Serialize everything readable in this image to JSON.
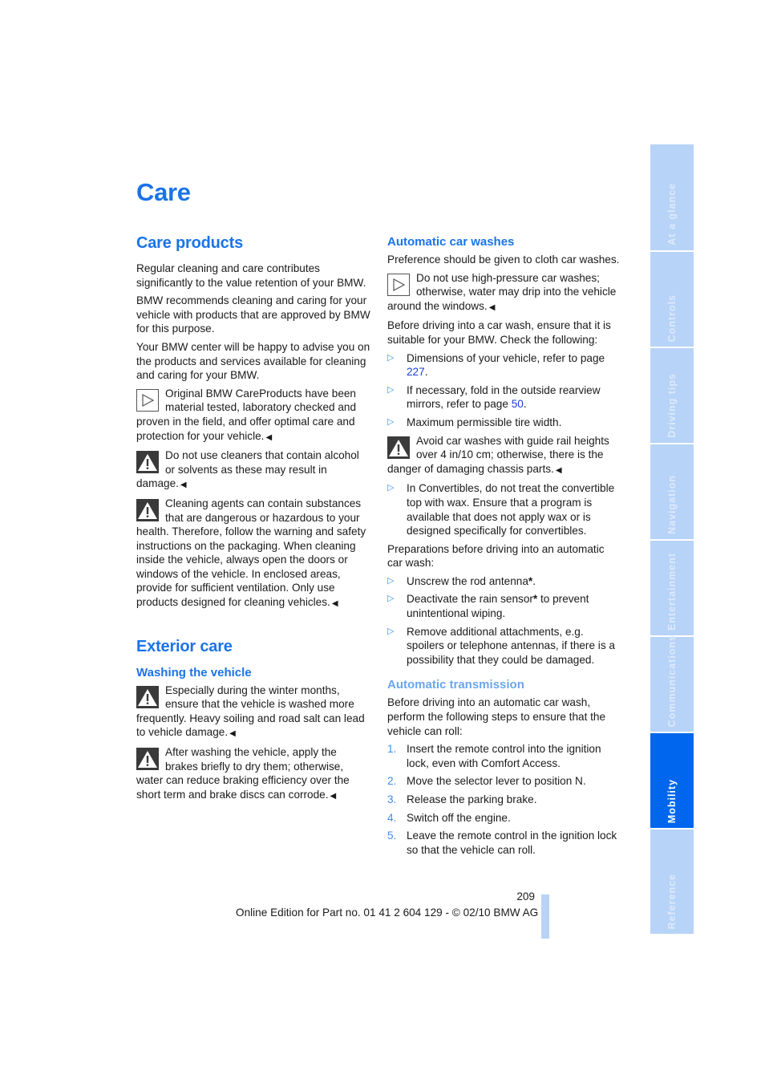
{
  "page": {
    "title": "Care",
    "accent_color": "#1a73e8",
    "link_color": "#1a3fd6"
  },
  "left": {
    "care_products": {
      "heading": "Care products",
      "paragraphs": [
        "Regular cleaning and care contributes significantly to the value retention of your BMW.",
        "BMW recommends cleaning and caring for your vehicle with products that are approved by BMW for this purpose.",
        "Your BMW center will be happy to advise you on the products and services available for cleaning and caring for your BMW."
      ],
      "notes": [
        {
          "icon": "note-triangle-icon",
          "text": "Original BMW CareProducts have been material tested, laboratory checked and proven in the field, and offer optimal care and protection for your vehicle."
        },
        {
          "icon": "warning-icon",
          "text": "Do not use cleaners that contain alcohol or solvents as these may result in damage."
        },
        {
          "icon": "warning-icon",
          "text": "Cleaning agents can contain substances that are dangerous or hazardous to your health. Therefore, follow the warning and safety instructions on the packaging. When cleaning inside the vehicle, always open the doors or windows of the vehicle. In enclosed areas, provide for sufficient ventilation. Only use products designed for cleaning vehicles."
        }
      ]
    },
    "exterior_care": {
      "heading": "Exterior care",
      "subheading": "Washing the vehicle",
      "notes": [
        {
          "icon": "warning-icon",
          "text": "Especially during the winter months, ensure that the vehicle is washed more frequently. Heavy soiling and road salt can lead to vehicle damage."
        },
        {
          "icon": "warning-icon",
          "text": "After washing the vehicle, apply the brakes briefly to dry them; otherwise, water can reduce braking efficiency over the short term and brake discs can corrode."
        }
      ]
    }
  },
  "right": {
    "car_washes": {
      "heading": "Automatic car washes",
      "intro": "Preference should be given to cloth car washes.",
      "note1": "Do not use high-pressure car washes; otherwise, water may drip into the vehicle around the windows.",
      "check_intro": "Before driving into a car wash, ensure that it is suitable for your BMW. Check the following:",
      "checks": [
        {
          "text": "Dimensions of your vehicle, refer to page ",
          "link": "227",
          "after": "."
        },
        {
          "text": "If necessary, fold in the outside rearview mirrors, refer to page ",
          "link": "50",
          "after": "."
        },
        {
          "text": "Maximum permissible tire width.",
          "link": "",
          "after": ""
        }
      ],
      "warning": "Avoid car washes with guide rail heights over 4 in/10 cm; otherwise, there is the danger of damaging chassis parts.",
      "convertible": "In Convertibles, do not treat the convertible top with wax. Ensure that a program is available that does not apply wax or is designed specifically for convertibles.",
      "prep_intro": "Preparations before driving into an automatic car wash:",
      "preps": [
        {
          "text": "Unscrew the rod antenna",
          "star": "*",
          "after": "."
        },
        {
          "text": "Deactivate the rain sensor",
          "star": "*",
          "after": " to prevent unintentional wiping."
        },
        {
          "text": "Remove additional attachments, e.g. spoilers or telephone antennas, if there is a possibility that they could be damaged.",
          "star": "",
          "after": ""
        }
      ]
    },
    "transmission": {
      "heading": "Automatic transmission",
      "intro": "Before driving into an automatic car wash, perform the following steps to ensure that the vehicle can roll:",
      "steps": [
        {
          "num": "1.",
          "text": "Insert the remote control into the ignition lock, even with Comfort Access."
        },
        {
          "num": "2.",
          "text": "Move the selector lever to position N."
        },
        {
          "num": "3.",
          "text": "Release the parking brake."
        },
        {
          "num": "4.",
          "text": "Switch off the engine."
        },
        {
          "num": "5.",
          "text": "Leave the remote control in the ignition lock so that the vehicle can roll."
        }
      ]
    }
  },
  "footer": {
    "page_number": "209",
    "edition": "Online Edition for Part no. 01 41 2 604 129 - © 02/10 BMW AG"
  },
  "sidebar": {
    "tabs": [
      {
        "label": "At a glance",
        "active": false
      },
      {
        "label": "Controls",
        "active": false
      },
      {
        "label": "Driving tips",
        "active": false
      },
      {
        "label": "Navigation",
        "active": false
      },
      {
        "label": "Entertainment",
        "active": false
      },
      {
        "label": "Communications",
        "active": false
      },
      {
        "label": "Mobility",
        "active": true
      },
      {
        "label": "Reference",
        "active": false
      }
    ],
    "tab_color": "#b7d3f7",
    "active_color": "#0066ee"
  },
  "symbols": {
    "end_mark": "◀",
    "bullet": "▷"
  }
}
